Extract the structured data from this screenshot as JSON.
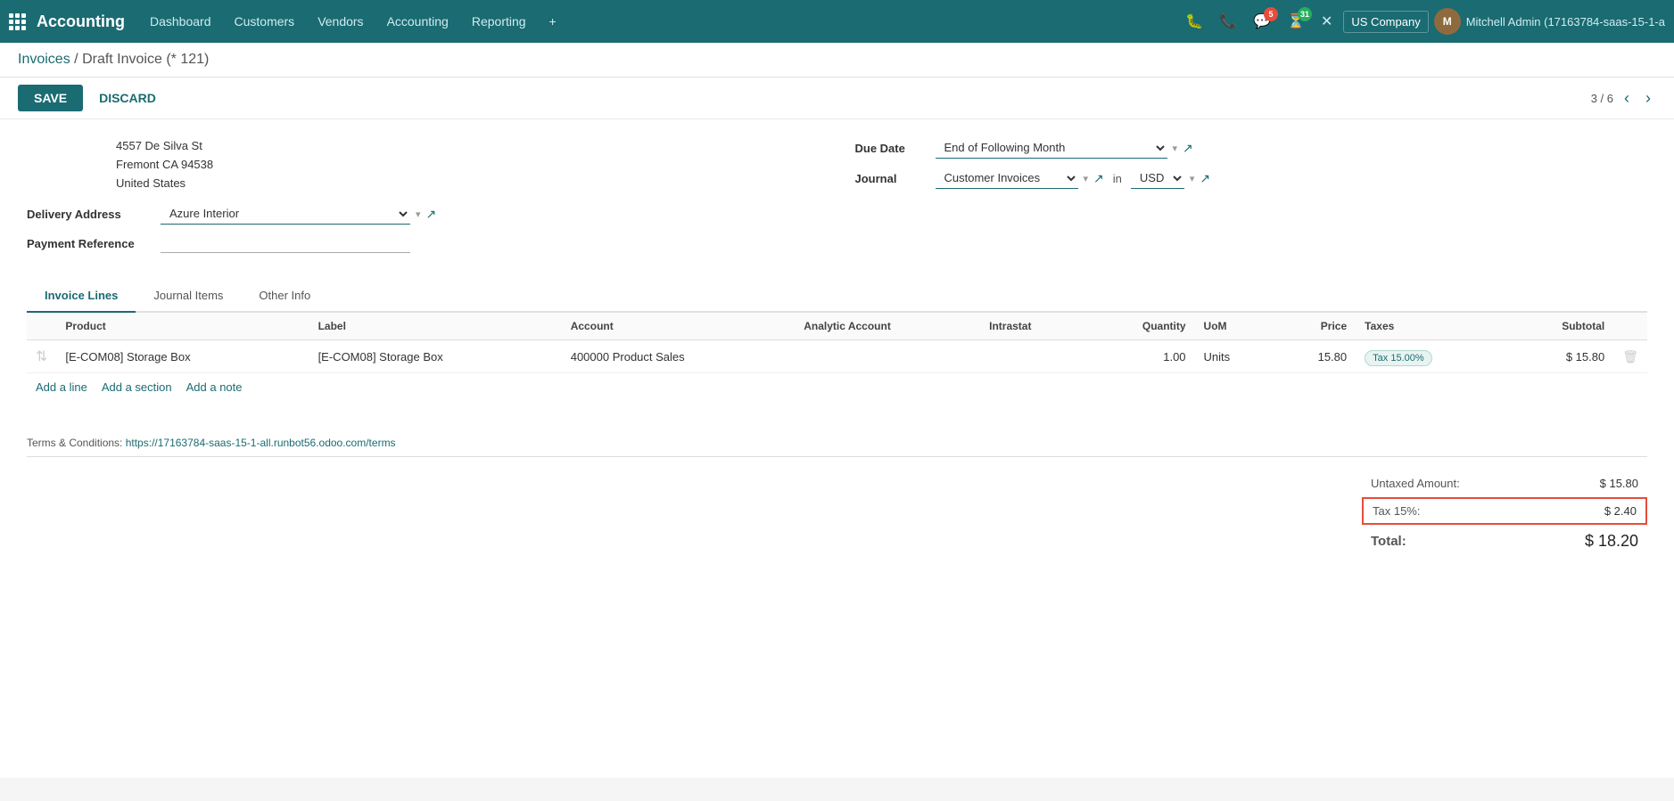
{
  "app": {
    "name": "Accounting",
    "logo_grid": true
  },
  "topnav": {
    "menu": [
      "Dashboard",
      "Customers",
      "Vendors",
      "Accounting",
      "Reporting"
    ],
    "plus_label": "+",
    "company": "US Company",
    "user_name": "Mitchell Admin (17163784-saas-15-1-a",
    "notifications": {
      "chat_count": "5",
      "clock_count": "31"
    }
  },
  "breadcrumb": {
    "parent": "Invoices",
    "separator": "/",
    "current": "Draft Invoice (* 121)"
  },
  "toolbar": {
    "save_label": "SAVE",
    "discard_label": "DISCARD",
    "pager": "3 / 6"
  },
  "form": {
    "address": {
      "line1": "4557 De Silva St",
      "line2": "Fremont CA 94538",
      "line3": "United States"
    },
    "delivery_address_label": "Delivery Address",
    "delivery_address_value": "Azure Interior",
    "payment_reference_label": "Payment Reference",
    "payment_reference_value": "",
    "due_date_label": "Due Date",
    "due_date_value": "End of Following Month",
    "journal_label": "Journal",
    "journal_value": "Customer Invoices",
    "currency_label": "in",
    "currency_value": "USD"
  },
  "tabs": [
    {
      "label": "Invoice Lines",
      "active": true
    },
    {
      "label": "Journal Items",
      "active": false
    },
    {
      "label": "Other Info",
      "active": false
    }
  ],
  "table": {
    "columns": [
      "Product",
      "Label",
      "Account",
      "Analytic Account",
      "Intrastat",
      "Quantity",
      "UoM",
      "Price",
      "Taxes",
      "Subtotal"
    ],
    "rows": [
      {
        "product": "[E-COM08] Storage Box",
        "label": "[E-COM08] Storage Box",
        "account": "400000 Product Sales",
        "analytic_account": "",
        "intrastat": "",
        "quantity": "1.00",
        "uom": "Units",
        "price": "15.80",
        "taxes": "Tax 15.00%",
        "subtotal": "$ 15.80"
      }
    ],
    "add_line": "Add a line",
    "add_section": "Add a section",
    "add_note": "Add a note"
  },
  "footer": {
    "terms_label": "Terms & Conditions:",
    "terms_link": "https://17163784-saas-15-1-all.runbot56.odoo.com/terms",
    "totals": {
      "untaxed_label": "Untaxed Amount:",
      "untaxed_value": "$ 15.80",
      "tax_label": "Tax 15%:",
      "tax_value": "$ 2.40",
      "total_label": "Total:",
      "total_value": "$ 18.20"
    }
  }
}
